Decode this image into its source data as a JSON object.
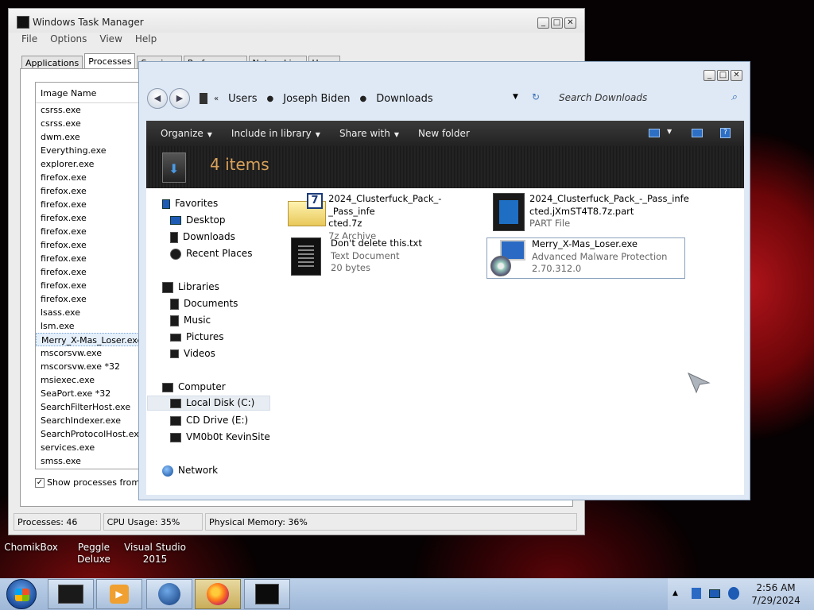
{
  "desktop": {
    "icons": [
      "ChomikBox",
      "Peggle Deluxe",
      "Visual Studio\n2015"
    ]
  },
  "taskmgr": {
    "title": "Windows Task Manager",
    "menu": [
      "File",
      "Options",
      "View",
      "Help"
    ],
    "tabs": [
      "Applications",
      "Processes",
      "Services",
      "Performance",
      "Networking",
      "Users"
    ],
    "active_tab": "Processes",
    "column_header": "Image Name",
    "processes": [
      "csrss.exe",
      "csrss.exe",
      "dwm.exe",
      "Everything.exe",
      "explorer.exe",
      "firefox.exe",
      "firefox.exe",
      "firefox.exe",
      "firefox.exe",
      "firefox.exe",
      "firefox.exe",
      "firefox.exe",
      "firefox.exe",
      "firefox.exe",
      "firefox.exe",
      "lsass.exe",
      "lsm.exe",
      "Merry_X-Mas_Loser.exe *",
      "mscorsvw.exe",
      "mscorsvw.exe *32",
      "msiexec.exe",
      "SeaPort.exe *32",
      "SearchFilterHost.exe",
      "SearchIndexer.exe",
      "SearchProtocolHost.exe",
      "services.exe",
      "smss.exe"
    ],
    "selected_process": "Merry_X-Mas_Loser.exe *",
    "show_all_label": "Show processes from all",
    "show_all_checked": true,
    "status": {
      "processes": "Processes: 46",
      "cpu": "CPU Usage: 35%",
      "memory": "Physical Memory: 36%"
    }
  },
  "explorer": {
    "breadcrumb": [
      "Users",
      "Joseph Biden",
      "Downloads"
    ],
    "search_placeholder": "Search Downloads",
    "toolbar": {
      "organize": "Organize",
      "include": "Include in library",
      "share": "Share with",
      "new_folder": "New folder"
    },
    "item_count": "4 items",
    "nav": {
      "favorites": "Favorites",
      "desktop": "Desktop",
      "downloads": "Downloads",
      "recent": "Recent Places",
      "libraries": "Libraries",
      "documents": "Documents",
      "music": "Music",
      "pictures": "Pictures",
      "videos": "Videos",
      "computer": "Computer",
      "local_disk": "Local Disk (C:)",
      "cd_drive": "CD Drive (E:)",
      "vm": "VM0b0t KevinSite",
      "network": "Network"
    },
    "files": [
      {
        "name1": "2024_Clusterfuck_Pack_-_Pass_infe",
        "name2": "cted.7z",
        "sub1": "7z Archive",
        "sub2": "",
        "icon": "7z-archive-icon"
      },
      {
        "name1": "2024_Clusterfuck_Pack_-_Pass_infe",
        "name2": "cted.jXmST4T8.7z.part",
        "sub1": "PART File",
        "sub2": "",
        "icon": "part-file-icon"
      },
      {
        "name1": "Don't delete this.txt",
        "name2": "",
        "sub1": "Text Document",
        "sub2": "20 bytes",
        "icon": "text-document-icon"
      },
      {
        "name1": "Merry_X-Mas_Loser.exe",
        "name2": "",
        "sub1": "Advanced Malware Protection",
        "sub2": "2.70.312.0",
        "icon": "installer-icon"
      }
    ]
  },
  "taskbar": {
    "time": "2:56 AM",
    "date": "7/29/2024",
    "buttons": [
      "explorer-icon",
      "media-player-icon",
      "globe-icon",
      "firefox-icon",
      "task-manager-icon"
    ],
    "active_button": "firefox-icon"
  },
  "colors": {
    "desktop_red": "#b0141a",
    "explorer_accent": "#d9a25a",
    "taskbar": "#bcd0e8"
  }
}
